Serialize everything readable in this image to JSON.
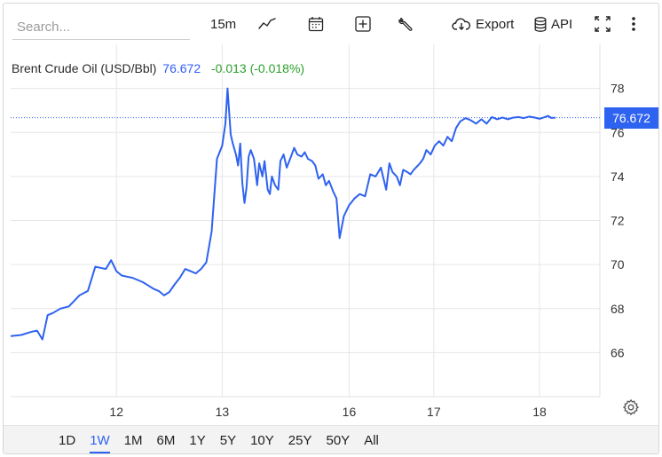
{
  "toolbar": {
    "search_placeholder": "Search...",
    "interval": "15m",
    "export_label": "Export",
    "api_label": "API",
    "icons": [
      "line-chart-icon",
      "calendar-icon",
      "plus-box-icon",
      "wrench-icon",
      "cloud-download-icon",
      "database-icon",
      "fullscreen-icon",
      "more-vertical-icon"
    ]
  },
  "legend": {
    "name": "Brent Crude Oil (USD/Bbl)",
    "last": "76.672",
    "change": "-0.013 (-0.018%)"
  },
  "price_tag": "76.672",
  "colors": {
    "line": "#2e62f0",
    "change": "#2ca02c",
    "grid": "#e6e6e6"
  },
  "chart_data": {
    "type": "line",
    "title": "Brent Crude Oil (USD/Bbl)",
    "ylim": [
      64,
      80
    ],
    "yticks": [
      66,
      68,
      70,
      72,
      74,
      76,
      78
    ],
    "grid": true,
    "xticks": [
      {
        "label": "12",
        "x": 3.25
      },
      {
        "label": "13",
        "x": 4.25
      },
      {
        "label": "16",
        "x": 5.45
      },
      {
        "label": "17",
        "x": 6.25
      },
      {
        "label": "18",
        "x": 7.25
      }
    ],
    "last_value": 76.672,
    "series": [
      {
        "name": "Brent Crude Oil (USD/Bbl)",
        "x": [
          2.25,
          2.35,
          2.45,
          2.5,
          2.55,
          2.6,
          2.65,
          2.72,
          2.8,
          2.9,
          2.98,
          3.05,
          3.1,
          3.15,
          3.2,
          3.25,
          3.3,
          3.35,
          3.4,
          3.45,
          3.5,
          3.55,
          3.6,
          3.65,
          3.7,
          3.75,
          3.8,
          3.85,
          3.9,
          3.95,
          4.0,
          4.05,
          4.1,
          4.15,
          4.2,
          4.25,
          4.28,
          4.3,
          4.33,
          4.35,
          4.38,
          4.4,
          4.42,
          4.44,
          4.46,
          4.48,
          4.5,
          4.52,
          4.55,
          4.58,
          4.6,
          4.63,
          4.65,
          4.68,
          4.7,
          4.72,
          4.75,
          4.78,
          4.8,
          4.83,
          4.86,
          4.9,
          4.93,
          4.96,
          5.0,
          5.03,
          5.06,
          5.1,
          5.13,
          5.16,
          5.2,
          5.23,
          5.26,
          5.3,
          5.33,
          5.36,
          5.4,
          5.45,
          5.5,
          5.55,
          5.6,
          5.65,
          5.7,
          5.75,
          5.8,
          5.83,
          5.86,
          5.9,
          5.93,
          5.96,
          6.0,
          6.03,
          6.06,
          6.08,
          6.1,
          6.12,
          6.15,
          6.18,
          6.22,
          6.26,
          6.3,
          6.34,
          6.38,
          6.42,
          6.46,
          6.5,
          6.55,
          6.6,
          6.65,
          6.7,
          6.75,
          6.8,
          6.85,
          6.9,
          6.95,
          7.0,
          7.05,
          7.1,
          7.15,
          7.2,
          7.25,
          7.3,
          7.33,
          7.36,
          7.4
        ],
        "values": [
          66.75,
          66.8,
          66.95,
          67.0,
          66.6,
          67.7,
          67.8,
          68.0,
          68.1,
          68.6,
          68.8,
          69.9,
          69.85,
          69.8,
          70.2,
          69.7,
          69.5,
          69.45,
          69.4,
          69.3,
          69.2,
          69.05,
          68.9,
          68.8,
          68.6,
          68.75,
          69.1,
          69.4,
          69.8,
          69.7,
          69.6,
          69.8,
          70.1,
          71.5,
          74.8,
          75.4,
          76.4,
          78.0,
          75.9,
          75.5,
          75.0,
          74.5,
          75.5,
          73.7,
          72.8,
          73.5,
          74.9,
          75.2,
          74.8,
          73.6,
          74.6,
          74.0,
          74.7,
          73.4,
          73.2,
          74.0,
          73.6,
          73.4,
          74.7,
          75.0,
          74.4,
          74.9,
          75.3,
          75.0,
          74.9,
          75.1,
          74.8,
          74.7,
          74.5,
          73.9,
          74.1,
          73.6,
          73.8,
          73.3,
          73.0,
          71.2,
          72.2,
          72.7,
          73.0,
          73.2,
          73.1,
          74.1,
          74.0,
          74.4,
          73.4,
          74.6,
          74.2,
          74.0,
          73.6,
          74.3,
          74.2,
          74.1,
          74.3,
          74.4,
          74.5,
          74.6,
          74.8,
          75.2,
          75.0,
          75.4,
          75.6,
          75.4,
          75.8,
          75.6,
          76.2,
          76.5,
          76.65,
          76.55,
          76.4,
          76.6,
          76.4,
          76.7,
          76.6,
          76.68,
          76.6,
          76.67,
          76.7,
          76.65,
          76.72,
          76.68,
          76.62,
          76.7,
          76.75,
          76.66,
          76.672
        ]
      }
    ]
  },
  "ranges": [
    "1D",
    "1W",
    "1M",
    "6M",
    "1Y",
    "5Y",
    "10Y",
    "25Y",
    "50Y",
    "All"
  ],
  "active_range": "1W"
}
